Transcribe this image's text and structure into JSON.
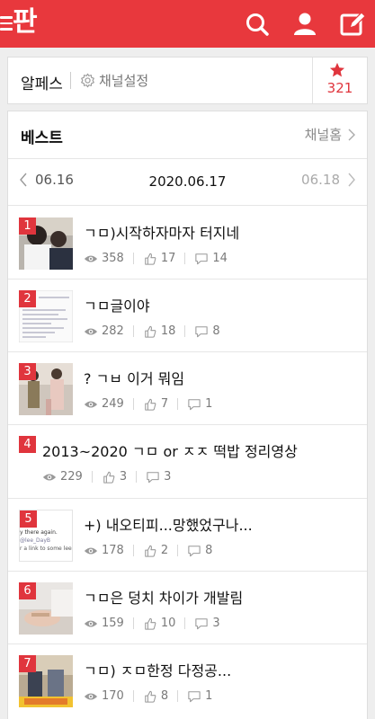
{
  "app": {
    "logo_text": "판",
    "accent": "#e8383d"
  },
  "topbar": {
    "icons": [
      "menu-icon",
      "search-icon",
      "user-icon",
      "write-icon"
    ]
  },
  "channel": {
    "name": "알페스",
    "settings_label": "채널설정",
    "favorite_count": "321"
  },
  "best": {
    "title": "베스트",
    "home_label": "채널홈"
  },
  "dates": {
    "prev": "06.16",
    "current": "2020.06.17",
    "next": "06.18"
  },
  "posts": [
    {
      "rank": "1",
      "title": "ㄱㅁ)시작하자마자 터지네",
      "views": "358",
      "likes": "17",
      "comments": "14"
    },
    {
      "rank": "2",
      "title": "ㄱㅁ글이야",
      "views": "282",
      "likes": "18",
      "comments": "8"
    },
    {
      "rank": "3",
      "title": "? ㄱㅂ 이거 뭐임",
      "views": "249",
      "likes": "7",
      "comments": "1"
    },
    {
      "rank": "4",
      "title": "2013~2020 ㄱㅁ or ㅈㅈ 떡밥 정리영상",
      "views": "229",
      "likes": "3",
      "comments": "3"
    },
    {
      "rank": "5",
      "title": "+) 내오티피...망했었구나...",
      "views": "178",
      "likes": "2",
      "comments": "8",
      "thumb_text": [
        "y there again.",
        "@lee_DayB",
        "r a link to some leedi fan"
      ]
    },
    {
      "rank": "6",
      "title": "ㄱㅁ은 덩치 차이가 개발림",
      "views": "159",
      "likes": "10",
      "comments": "3"
    },
    {
      "rank": "7",
      "title": "ㄱㅁ) ㅈㅁ한정 다정공...",
      "views": "170",
      "likes": "8",
      "comments": "1"
    }
  ]
}
